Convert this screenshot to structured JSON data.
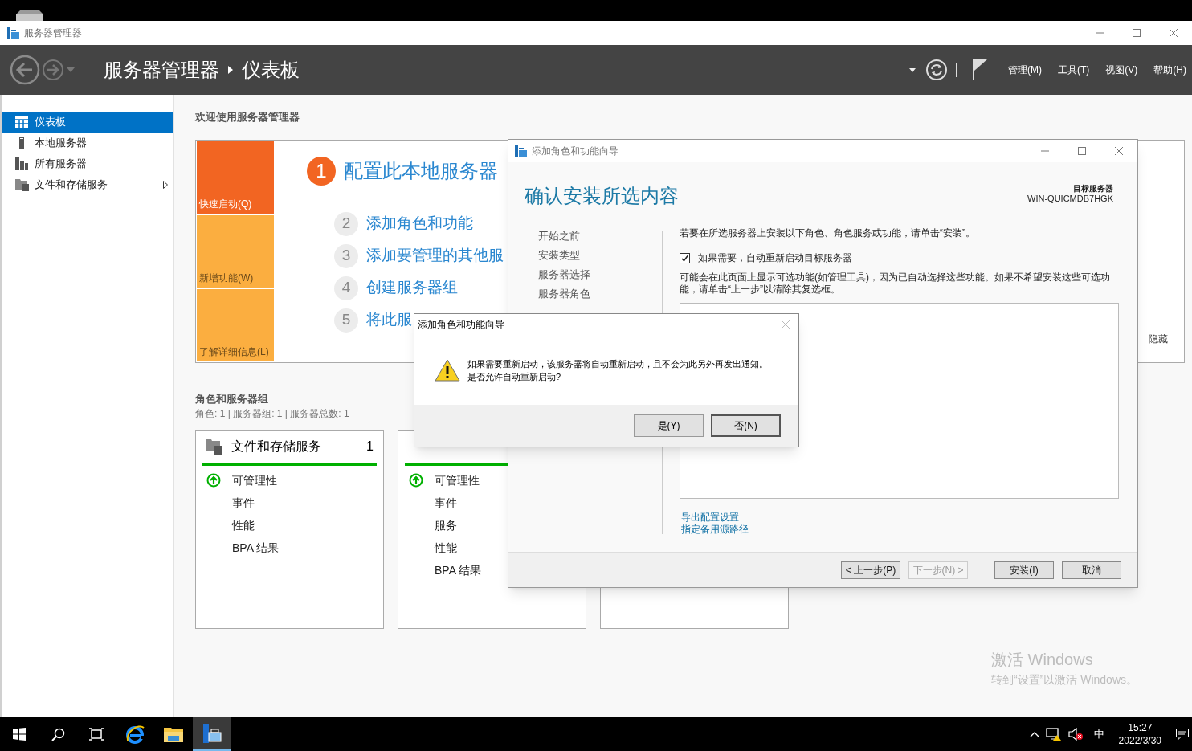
{
  "app_window": {
    "title": "服务器管理器"
  },
  "header": {
    "breadcrumb": [
      "服务器管理器",
      "仪表板"
    ],
    "menus": [
      "管理(M)",
      "工具(T)",
      "视图(V)",
      "帮助(H)"
    ]
  },
  "sidebar": {
    "items": [
      {
        "label": "仪表板",
        "kind": "dashboard",
        "selected": true,
        "has_arrow": false
      },
      {
        "label": "本地服务器",
        "kind": "server",
        "selected": false,
        "has_arrow": false
      },
      {
        "label": "所有服务器",
        "kind": "servers",
        "selected": false,
        "has_arrow": false
      },
      {
        "label": "文件和存储服务",
        "kind": "files",
        "selected": false,
        "has_arrow": true
      }
    ]
  },
  "welcome": {
    "heading": "欢迎使用服务器管理器",
    "tiles": [
      {
        "label": "快速启动(Q)",
        "color": "#f26522"
      },
      {
        "label": "新增功能(W)",
        "color": "#fbae40"
      },
      {
        "label": "了解详细信息(L)",
        "color": "#fbae40"
      }
    ],
    "steps": [
      {
        "number": "1",
        "label": "配置此本地服务器",
        "kind": "primary"
      },
      {
        "number": "2",
        "label": "添加角色和功能",
        "kind": "secondary"
      },
      {
        "number": "3",
        "label": "添加要管理的其他服",
        "kind": "secondary"
      },
      {
        "number": "4",
        "label": "创建服务器组",
        "kind": "secondary"
      },
      {
        "number": "5",
        "label": "将此服",
        "kind": "secondary"
      }
    ],
    "hide_link": "隐藏"
  },
  "roles": {
    "heading": "角色和服务器组",
    "summary": "角色: 1 | 服务器组: 1 | 服务器总数: 1",
    "cards": [
      {
        "kind": "tile",
        "title": "文件和存储服务",
        "count": "1",
        "items": [
          {
            "label": "可管理性",
            "ok": true
          },
          {
            "label": "事件",
            "ok": false
          },
          {
            "label": "性能",
            "ok": false
          },
          {
            "label": "BPA 结果",
            "ok": false
          }
        ]
      },
      {
        "kind": "tile",
        "items": [
          {
            "label": "可管理性",
            "ok": true
          },
          {
            "label": "事件",
            "ok": false
          },
          {
            "label": "服务",
            "ok": false
          },
          {
            "label": "性能",
            "ok": false
          },
          {
            "label": "BPA 结果",
            "ok": false
          }
        ]
      },
      {
        "kind": "empty"
      }
    ]
  },
  "wizard": {
    "title": "添加角色和功能向导",
    "heading": "确认安装所选内容",
    "target_label": "目标服务器",
    "target_server": "WIN-QUICMDB7HGK",
    "nav": [
      "开始之前",
      "安装类型",
      "服务器选择",
      "服务器角色"
    ],
    "instruction": "若要在所选服务器上安装以下角色、角色服务或功能，请单击“安装”。",
    "restart_option": {
      "label": "如果需要，自动重新启动目标服务器",
      "checked": true
    },
    "note": "可能会在此页面上显示可选功能(如管理工具)，因为已自动选择这些功能。如果不希望安装这些可选功能，请单击“上一步”以清除其复选框。",
    "links": [
      "导出配置设置",
      "指定备用源路径"
    ],
    "nav_buttons": [
      {
        "label": "< 上一步(P)",
        "disabled": false
      },
      {
        "label": "下一步(N) >",
        "disabled": true
      }
    ],
    "action_buttons": [
      {
        "label": "安装(I)",
        "disabled": false
      },
      {
        "label": "取消",
        "disabled": false
      }
    ]
  },
  "dialog": {
    "title": "添加角色和功能向导",
    "message_lines": [
      "如果需要重新启动，该服务器将自动重新启动，且不会为此另外再发出通知。",
      "是否允许自动重新启动?"
    ],
    "buttons": [
      {
        "label": "是(Y)",
        "default": false
      },
      {
        "label": "否(N)",
        "default": true
      }
    ]
  },
  "activation": {
    "title": "激活 Windows",
    "subtitle": "转到“设置”以激活 Windows。"
  },
  "taskbar": {
    "apps": [
      {
        "kind": "start",
        "active": false
      },
      {
        "kind": "search",
        "active": false
      },
      {
        "kind": "taskview",
        "active": false
      },
      {
        "kind": "browser",
        "active": false
      },
      {
        "kind": "folder",
        "active": false
      },
      {
        "kind": "server_manager",
        "active": true
      }
    ],
    "ime": "中",
    "time": "15:27",
    "date": "2022/3/30"
  }
}
